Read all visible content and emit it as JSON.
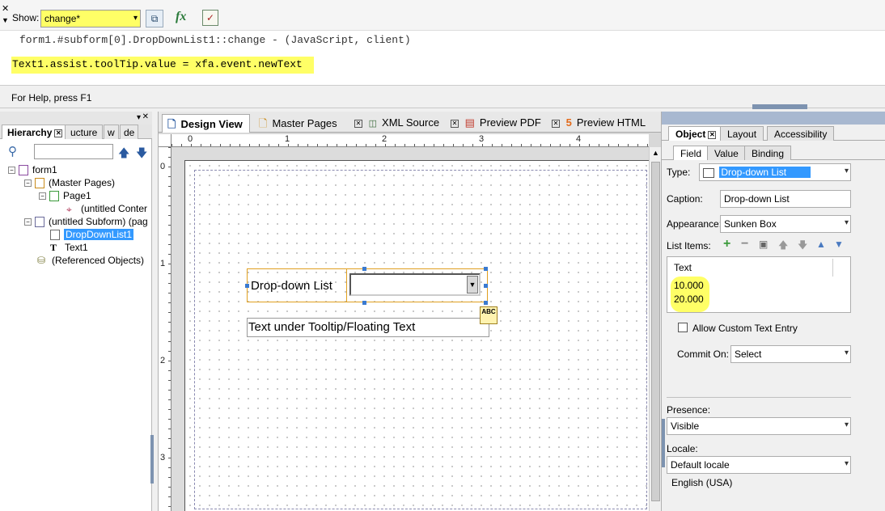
{
  "toolbar": {
    "show_label": "Show:",
    "show_value": "change*",
    "fx_label": "fx"
  },
  "script": {
    "header": "form1.#subform[0].DropDownList1::change - (JavaScript, client)",
    "code": "Text1.assist.toolTip.value = xfa.event.newText"
  },
  "status": {
    "help_text": "For Help, press F1"
  },
  "hierarchy": {
    "tabs": [
      "Hierarchy",
      "ucture",
      "w",
      "de"
    ],
    "tree": [
      {
        "label": "form1"
      },
      {
        "label": "(Master Pages)"
      },
      {
        "label": "Page1"
      },
      {
        "label": "(untitled Conter"
      },
      {
        "label": "(untitled Subform) (pag"
      },
      {
        "label": "DropDownList1"
      },
      {
        "label": "Text1"
      },
      {
        "label": "(Referenced Objects)"
      }
    ]
  },
  "design": {
    "tabs": [
      "Design View",
      "Master Pages",
      "XML Source",
      "Preview PDF",
      "Preview HTML"
    ],
    "ruler_h": [
      "0",
      "1",
      "2",
      "3",
      "4"
    ],
    "ruler_v": [
      "0",
      "1",
      "2",
      "3"
    ],
    "dropdown_caption": "Drop-down List",
    "text_field": "Text under Tooltip/Floating Text",
    "text_badge": "ABC"
  },
  "object_panel": {
    "tabs": [
      "Object",
      "Layout",
      "Accessibility"
    ],
    "subtabs": [
      "Field",
      "Value",
      "Binding"
    ],
    "type_label": "Type:",
    "type_value": "Drop-down List",
    "caption_label": "Caption:",
    "caption_value": "Drop-down List",
    "appearance_label": "Appearance:",
    "appearance_value": "Sunken Box",
    "list_items_label": "List Items:",
    "list_header": "Text",
    "list_items": [
      "10.000",
      "20.000"
    ],
    "allow_custom_label": "Allow Custom Text Entry",
    "commit_label": "Commit On:",
    "commit_value": "Select",
    "presence_label": "Presence:",
    "presence_value": "Visible",
    "locale_label": "Locale:",
    "locale_value": "Default locale",
    "locale_display": "English (USA)"
  },
  "colors": {
    "highlight": "#ffff66",
    "selection": "#3399ff"
  }
}
